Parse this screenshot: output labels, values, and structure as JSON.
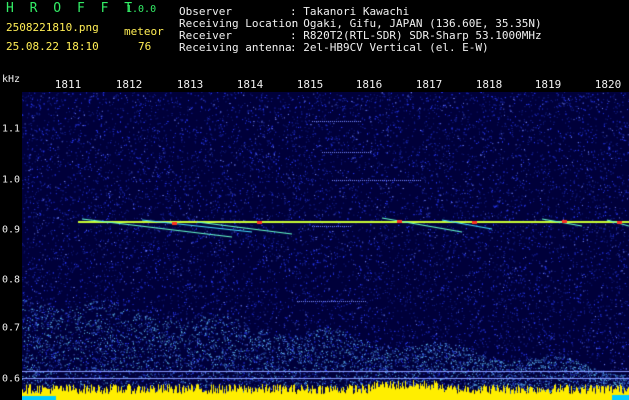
{
  "header": {
    "app_title": "H R O F F T",
    "version": "1.0.0",
    "file_name": "2508221810.png",
    "datetime": "25.08.22 18:10",
    "mode_label": "meteor",
    "meteor_count": "76",
    "info_labels": [
      "Observer",
      "Receiving Location",
      "Receiver",
      "Receiving antenna"
    ],
    "info_values": [
      ": Takanori Kawachi",
      ": Ogaki, Gifu, JAPAN (136.60E, 35.35N)",
      ": R820T2(RTL-SDR) SDR-Sharp 53.1000MHz",
      ": 2el-HB9CV Vertical (el. E-W)"
    ]
  },
  "x_axis": {
    "ticks": [
      "1811",
      "1812",
      "1813",
      "1814",
      "1815",
      "1816",
      "1817",
      "1818",
      "1819",
      "1820"
    ]
  },
  "y_axis": {
    "unit": "kHz",
    "ticks": [
      "1.1",
      "1.0",
      "0.9",
      "0.8",
      "0.7",
      "0.6"
    ]
  },
  "colors": {
    "background": "#00003a",
    "noise": "#2a3cff",
    "carrier": "#ccff33",
    "echo": "#ff3322",
    "low_band_noise": "#66ccff",
    "bottom_band": "#ffee00",
    "bottom_band_edge": "#00ccff"
  }
}
